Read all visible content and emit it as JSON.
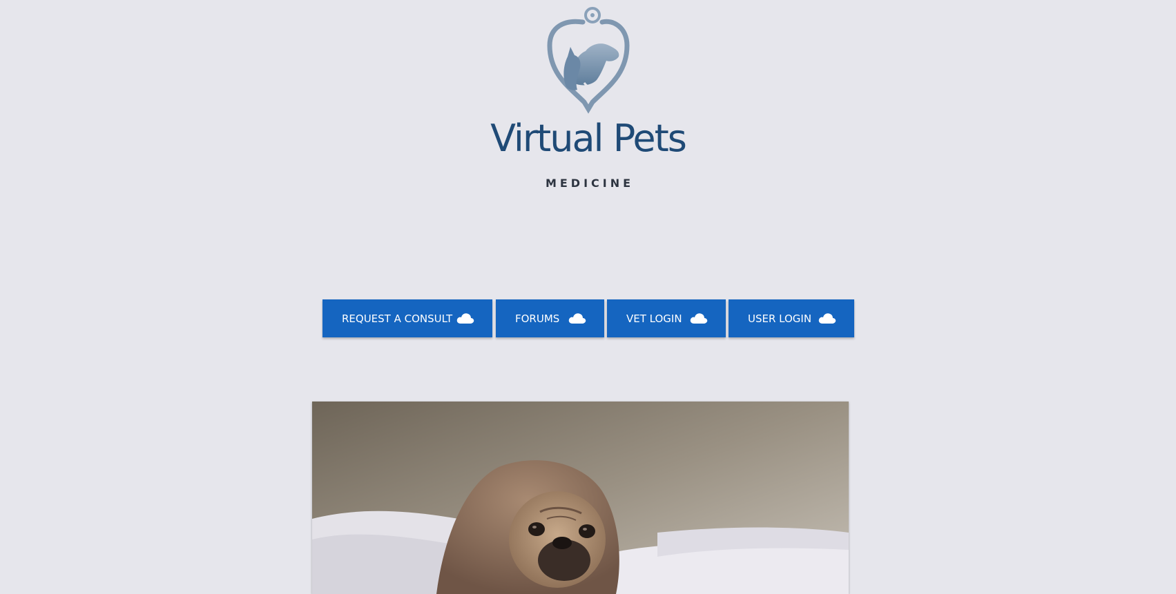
{
  "brand": {
    "name": "Virtual Pets",
    "subtitle": "MEDICINE",
    "logo_icon": "stethoscope-dog-cat-icon",
    "color": "#1f4a76"
  },
  "nav": {
    "accent": "#1565c0",
    "buttons": [
      {
        "label": "REQUEST A CONSULT",
        "icon": "cloud-icon"
      },
      {
        "label": "FORUMS",
        "icon": "cloud-icon"
      },
      {
        "label": "VET LOGIN",
        "icon": "cloud-icon"
      },
      {
        "label": "USER LOGIN",
        "icon": "cloud-icon"
      }
    ]
  },
  "hero_image": {
    "subject": "pug wrapped in a brown blanket on a bed"
  }
}
